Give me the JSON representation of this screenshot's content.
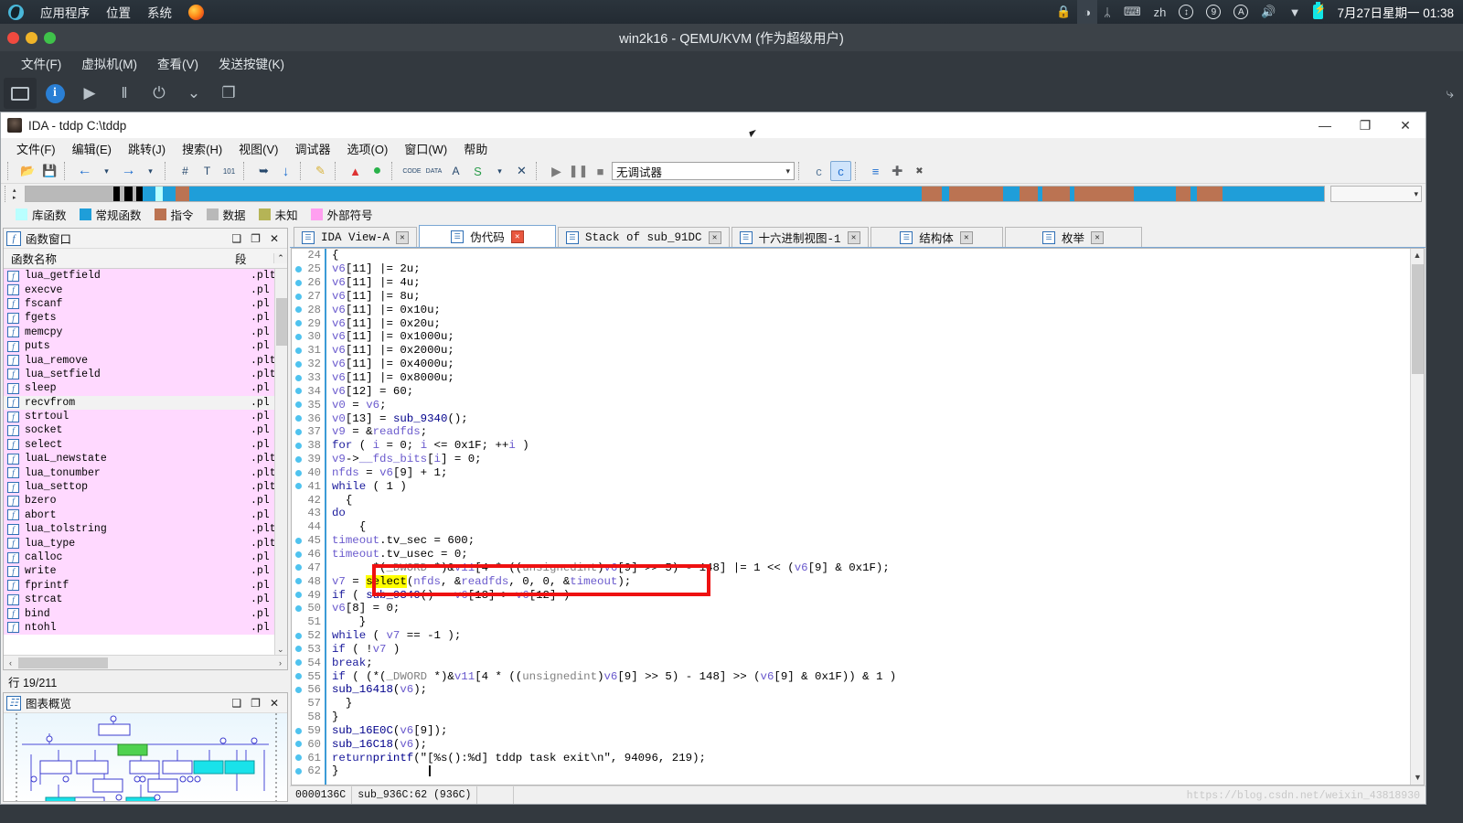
{
  "desktop": {
    "menu": [
      "应用程序",
      "位置",
      "系统"
    ],
    "logo_icon": "ubuntu-logo-icon",
    "firefox_icon": "firefox-icon",
    "tray": [
      {
        "name": "lock-icon",
        "glyph": "🔒"
      },
      {
        "name": "brightness-icon",
        "glyph": "◑"
      },
      {
        "name": "bluetooth-icon",
        "glyph": "ᛦ"
      },
      {
        "name": "keyboard-icon",
        "glyph": "⌨"
      },
      {
        "name": "input-method-label",
        "glyph": "zh"
      },
      {
        "name": "updates-icon",
        "glyph": "↕"
      },
      {
        "name": "notifications-count-icon",
        "glyph": "9"
      },
      {
        "name": "accessibility-icon",
        "glyph": "A"
      },
      {
        "name": "volume-icon",
        "glyph": "🔊"
      },
      {
        "name": "wifi-icon",
        "glyph": "▼"
      },
      {
        "name": "battery-icon",
        "glyph": ""
      }
    ],
    "clock": "7月27日星期一 01:38"
  },
  "vm_window": {
    "title": "win2k16 - QEMU/KVM (作为超级用户)",
    "menu": [
      "文件(F)",
      "虚拟机(M)",
      "查看(V)",
      "发送按键(K)"
    ],
    "toolbar": [
      {
        "name": "console-view-button",
        "glyph": ""
      },
      {
        "name": "details-info-button",
        "glyph": "i"
      },
      {
        "name": "run-button",
        "glyph": "▶"
      },
      {
        "name": "pause-button",
        "glyph": "‖"
      },
      {
        "name": "shutdown-button",
        "glyph": "⏻"
      },
      {
        "name": "shutdown-menu-button",
        "glyph": "⌄"
      },
      {
        "name": "snapshots-button",
        "glyph": "❐"
      }
    ],
    "fullscreen_glyph": "⤷"
  },
  "ida": {
    "title": "IDA - tddp C:\\tddp",
    "window_buttons": [
      {
        "name": "minimize-button",
        "glyph": "—"
      },
      {
        "name": "restore-button",
        "glyph": "❐"
      },
      {
        "name": "close-button",
        "glyph": "✕"
      }
    ],
    "menu": [
      "文件(F)",
      "编辑(E)",
      "跳转(J)",
      "搜索(H)",
      "视图(V)",
      "调试器",
      "选项(O)",
      "窗口(W)",
      "帮助"
    ],
    "toolbar": {
      "open_label": "📂",
      "save_label": "💾",
      "back_label": "←",
      "back_menu_label": "▾",
      "forward_label": "→",
      "forward_menu_label": "▾",
      "search_hash_label": "#",
      "search_text_label": "T",
      "search_num_label": "101",
      "jump_label": "➥",
      "down_label": "↓",
      "pencil_label": "✎",
      "warn_label": "▲",
      "green_label": "●",
      "code_label": "CODE",
      "data_label": "DATA",
      "ascii_label": "A",
      "struct_label": "S",
      "struct_menu_label": "▾",
      "undef_label": "✕",
      "run_label": "▶",
      "pause_label": "❚❚",
      "stop_label": "■",
      "debugger_value": "无调试器",
      "debugger_arrow": "▾",
      "c_label": "c",
      "c_run_label": "c",
      "bp_list_label": "≡",
      "bp_add_label": "➕",
      "bp_del_label": "✖"
    },
    "navband": {
      "left_arrow": "▴",
      "right_arrow": "▸",
      "tail_arrow": "▾"
    },
    "legend": [
      {
        "label": "库函数",
        "color": "#b9ffff"
      },
      {
        "label": "常规函数",
        "color": "#1f9ed9"
      },
      {
        "label": "指令",
        "color": "#bb7352"
      },
      {
        "label": "数据",
        "color": "#b9b9b9"
      },
      {
        "label": "未知",
        "color": "#b5b456"
      },
      {
        "label": "外部符号",
        "color": "#ff9ff0"
      }
    ],
    "functions_panel": {
      "title": "函数窗口",
      "icon": "function-icon",
      "header_buttons": [
        {
          "name": "panel-maximize-button",
          "glyph": "❑"
        },
        {
          "name": "panel-restore-button",
          "glyph": "❐"
        },
        {
          "name": "panel-close-button",
          "glyph": "✕"
        }
      ],
      "columns": [
        "函数名称",
        "段"
      ],
      "rows": [
        {
          "name": "lua_getfield",
          "segment": ".plt"
        },
        {
          "name": "execve",
          "segment": ".pl"
        },
        {
          "name": "fscanf",
          "segment": ".pl"
        },
        {
          "name": "fgets",
          "segment": ".pl"
        },
        {
          "name": "memcpy",
          "segment": ".pl"
        },
        {
          "name": "puts",
          "segment": ".pl"
        },
        {
          "name": "lua_remove",
          "segment": ".plt"
        },
        {
          "name": "lua_setfield",
          "segment": ".plt"
        },
        {
          "name": "sleep",
          "segment": ".pl"
        },
        {
          "name": "recvfrom",
          "segment": ".pl",
          "selected": true
        },
        {
          "name": "strtoul",
          "segment": ".pl"
        },
        {
          "name": "socket",
          "segment": ".pl"
        },
        {
          "name": "select",
          "segment": ".pl"
        },
        {
          "name": "luaL_newstate",
          "segment": ".plt"
        },
        {
          "name": "lua_tonumber",
          "segment": ".plt"
        },
        {
          "name": "lua_settop",
          "segment": ".plt"
        },
        {
          "name": "bzero",
          "segment": ".pl"
        },
        {
          "name": "abort",
          "segment": ".pl"
        },
        {
          "name": "lua_tolstring",
          "segment": ".plt"
        },
        {
          "name": "lua_type",
          "segment": ".plt"
        },
        {
          "name": "calloc",
          "segment": ".pl"
        },
        {
          "name": "write",
          "segment": ".pl"
        },
        {
          "name": "fprintf",
          "segment": ".pl"
        },
        {
          "name": "strcat",
          "segment": ".pl"
        },
        {
          "name": "bind",
          "segment": ".pl"
        },
        {
          "name": "ntohl",
          "segment": ".pl"
        }
      ],
      "status": "行 19/211",
      "scroll_left_arrow": "‹",
      "scroll_right_arrow": "›",
      "scroll_up_arrow": "⌃",
      "scroll_down_arrow": "⌄"
    },
    "graph_panel": {
      "title": "图表概览",
      "icon": "graph-icon",
      "header_buttons": [
        {
          "name": "panel-maximize-button",
          "glyph": "❑"
        },
        {
          "name": "panel-restore-button",
          "glyph": "❐"
        },
        {
          "name": "panel-close-button",
          "glyph": "✕"
        }
      ]
    },
    "tabs": [
      {
        "label": "IDA View-A",
        "icon": "disasm-icon",
        "active": false
      },
      {
        "label": "伪代码",
        "icon": "pseudocode-icon",
        "active": true
      },
      {
        "label": "Stack of sub_91DC",
        "icon": "stack-icon",
        "active": false
      },
      {
        "label": "十六进制视图-1",
        "icon": "hex-icon",
        "active": false
      },
      {
        "label": "结构体",
        "icon": "struct-icon",
        "active": false
      },
      {
        "label": "枚举",
        "icon": "enum-icon",
        "active": false
      }
    ],
    "code": {
      "first_line": 24,
      "lines": [
        {
          "n": 24,
          "bp": false,
          "text": "{"
        },
        {
          "n": 25,
          "bp": true,
          "text": "  v6[11] |= 2u;"
        },
        {
          "n": 26,
          "bp": true,
          "text": "  v6[11] |= 4u;"
        },
        {
          "n": 27,
          "bp": true,
          "text": "  v6[11] |= 8u;"
        },
        {
          "n": 28,
          "bp": true,
          "text": "  v6[11] |= 0x10u;"
        },
        {
          "n": 29,
          "bp": true,
          "text": "  v6[11] |= 0x20u;"
        },
        {
          "n": 30,
          "bp": true,
          "text": "  v6[11] |= 0x1000u;"
        },
        {
          "n": 31,
          "bp": true,
          "text": "  v6[11] |= 0x2000u;"
        },
        {
          "n": 32,
          "bp": true,
          "text": "  v6[11] |= 0x4000u;"
        },
        {
          "n": 33,
          "bp": true,
          "text": "  v6[11] |= 0x8000u;"
        },
        {
          "n": 34,
          "bp": true,
          "text": "  v6[12] = 60;"
        },
        {
          "n": 35,
          "bp": true,
          "text": "  v0 = v6;"
        },
        {
          "n": 36,
          "bp": true,
          "text": "  v0[13] = sub_9340();"
        },
        {
          "n": 37,
          "bp": true,
          "text": "  v9 = &readfds;"
        },
        {
          "n": 38,
          "bp": true,
          "text": "  for ( i = 0; i <= 0x1F; ++i )"
        },
        {
          "n": 39,
          "bp": true,
          "text": "    v9->__fds_bits[i] = 0;"
        },
        {
          "n": 40,
          "bp": true,
          "text": "  nfds = v6[9] + 1;"
        },
        {
          "n": 41,
          "bp": true,
          "text": "  while ( 1 )"
        },
        {
          "n": 42,
          "bp": false,
          "text": "  {"
        },
        {
          "n": 43,
          "bp": false,
          "text": "    do"
        },
        {
          "n": 44,
          "bp": false,
          "text": "    {"
        },
        {
          "n": 45,
          "bp": true,
          "text": "      timeout.tv_sec = 600;"
        },
        {
          "n": 46,
          "bp": true,
          "text": "      timeout.tv_usec = 0;"
        },
        {
          "n": 47,
          "bp": true,
          "text": "      *(_DWORD *)&v11[4 * ((unsigned int)v6[9] >> 5) - 148] |= 1 << (v6[9] & 0x1F);"
        },
        {
          "n": 48,
          "bp": true,
          "text": "      v7 = select(nfds, &readfds, 0, 0, &timeout);"
        },
        {
          "n": 49,
          "bp": true,
          "text": "      if ( sub_9340() - v6[13] > v6[12] )"
        },
        {
          "n": 50,
          "bp": true,
          "text": "        v6[8] = 0;"
        },
        {
          "n": 51,
          "bp": false,
          "text": "    }"
        },
        {
          "n": 52,
          "bp": true,
          "text": "    while ( v7 == -1 );"
        },
        {
          "n": 53,
          "bp": true,
          "text": "    if ( !v7 )"
        },
        {
          "n": 54,
          "bp": true,
          "text": "      break;"
        },
        {
          "n": 55,
          "bp": true,
          "text": "    if ( (*(_DWORD *)&v11[4 * ((unsigned int)v6[9] >> 5) - 148] >> (v6[9] & 0x1F)) & 1 )"
        },
        {
          "n": 56,
          "bp": true,
          "text": "      sub_16418(v6);"
        },
        {
          "n": 57,
          "bp": false,
          "text": "  }"
        },
        {
          "n": 58,
          "bp": false,
          "text": "}"
        },
        {
          "n": 59,
          "bp": true,
          "text": "sub_16E0C(v6[9]);"
        },
        {
          "n": 60,
          "bp": true,
          "text": "sub_16C18(v6);"
        },
        {
          "n": 61,
          "bp": true,
          "text": "return printf(\"[%s():%d] tddp task exit\\n\", 94096, 219);"
        },
        {
          "n": 62,
          "bp": true,
          "text": "}"
        }
      ],
      "highlight_token": "select",
      "annotation_color": "#ee1111"
    },
    "status_bar": [
      "0000136C",
      "sub_936C:62 (936C)",
      ""
    ],
    "watermark": "https://blog.csdn.net/weixin_43818930"
  }
}
